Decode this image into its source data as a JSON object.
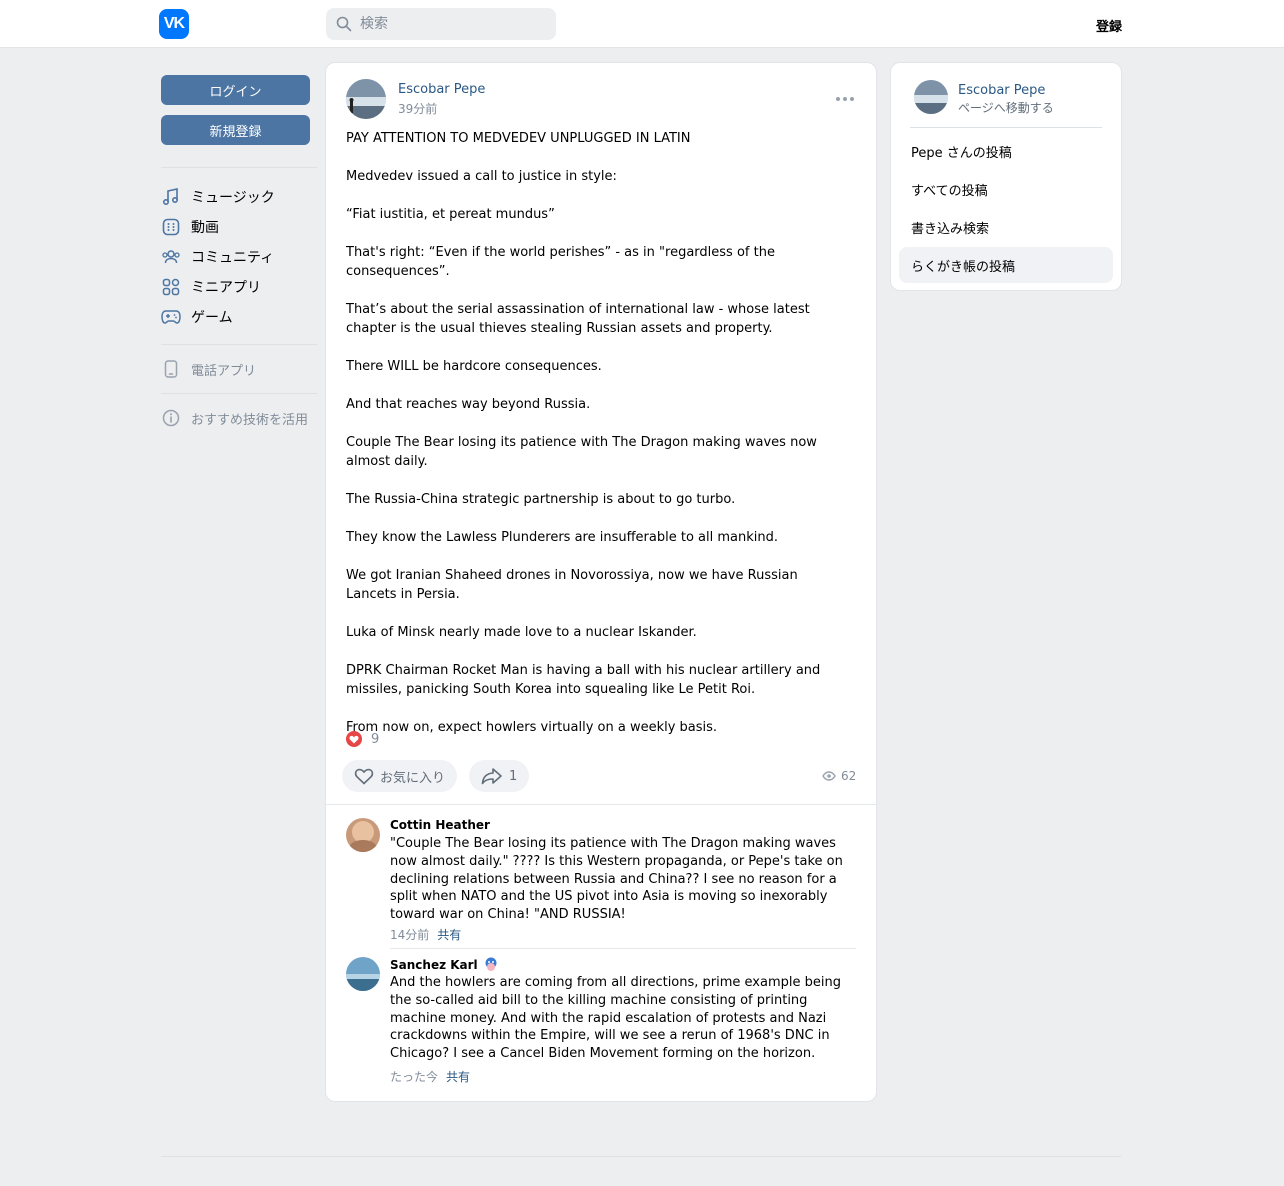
{
  "header": {
    "logo_text": "VK",
    "search_placeholder": "検索",
    "register_label": "登録"
  },
  "left_nav": {
    "login_label": "ログイン",
    "signup_label": "新規登録",
    "items": [
      {
        "label": "ミュージック",
        "icon": "music-icon"
      },
      {
        "label": "動画",
        "icon": "video-icon"
      },
      {
        "label": "コミュニティ",
        "icon": "community-icon"
      },
      {
        "label": "ミニアプリ",
        "icon": "mini-apps-icon"
      },
      {
        "label": "ゲーム",
        "icon": "gamepad-icon"
      }
    ],
    "phone_app_label": "電話アプリ",
    "recommended_tech_label": "おすすめ技術を活用"
  },
  "post": {
    "author": "Escobar Pepe",
    "time": "39分前",
    "paragraphs": [
      "PAY ATTENTION TO MEDVEDEV UNPLUGGED IN LATIN",
      "Medvedev issued a call to justice in style:",
      "“Fiat iustitia, et pereat mundus”",
      "That's right: “Even if the world perishes” - as in \"regardless of the consequences”.",
      "That’s about the serial assassination of international law - whose latest chapter is the usual thieves stealing Russian assets and property.",
      "There WILL be hardcore consequences.",
      "And that reaches way beyond Russia.",
      "Couple The Bear losing its patience with The Dragon making waves now almost daily.",
      "The Russia-China strategic partnership is about to go turbo.",
      "They know the Lawless Plunderers are insufferable to all mankind.",
      "We got Iranian Shaheed drones in Novorossiya, now we have Russian Lancets in Persia.",
      "Luka of Minsk nearly made love to a nuclear Iskander.",
      "DPRK Chairman Rocket Man is having a ball with his nuclear artillery and missiles, panicking South Korea into squealing like Le Petit Roi.",
      "From now on, expect howlers virtually on a weekly basis."
    ],
    "reaction_count": "9",
    "like_label": "お気に入り",
    "share_count": "1",
    "views": "62"
  },
  "comments": [
    {
      "name": "Cottin Heather",
      "text": "\"Couple The Bear losing its patience with The Dragon making waves now almost daily.\" ???? Is this Western propaganda, or Pepe's take on declining relations between Russia and China?? I see no reason for a split when NATO and the US pivot into Asia is moving so inexorably toward war on China! \"AND RUSSIA!",
      "time": "14分前",
      "share": "共有"
    },
    {
      "name": "Sanchez Karl",
      "text": "And the howlers are coming from all directions, prime example being the so-called aid bill to the killing machine consisting of printing machine money. And with the rapid escalation of protests and Nazi crackdowns within the Empire, will we see a rerun of 1968's DNC in Chicago? I see a Cancel Biden Movement forming on the horizon.",
      "time": "たった今",
      "share": "共有"
    }
  ],
  "sidebar": {
    "name": "Escobar Pepe",
    "sub": "ページへ移動する",
    "items": [
      {
        "label": "Pepe さんの投稿"
      },
      {
        "label": "すべての投稿"
      },
      {
        "label": "書き込み検索"
      },
      {
        "label": "らくがき帳の投稿"
      }
    ]
  },
  "colors": {
    "accent": "#0077ff",
    "button_blue": "#4c75a3",
    "link": "#2a5885",
    "like_red": "#e64646"
  }
}
